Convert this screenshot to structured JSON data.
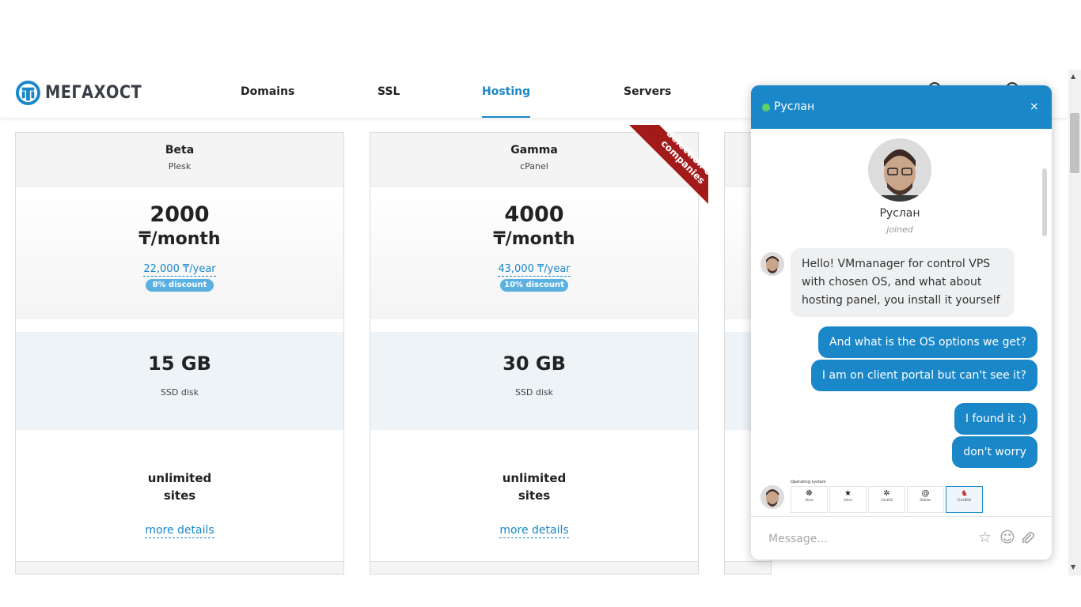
{
  "brand": {
    "logo_text": "МЕГАХОСТ"
  },
  "nav": {
    "domains": "Domains",
    "ssl": "SSL",
    "hosting": "Hosting",
    "servers": "Servers",
    "active": "Hosting"
  },
  "plans": [
    {
      "name": "Beta",
      "panel": "Plesk",
      "price": "2000",
      "price_unit": "₸/month",
      "price_year": "22,000 ₸/year",
      "discount": "8% discount",
      "disk": "15 GB",
      "disk_label": "SSD disk",
      "sites": "unlimited",
      "sites_label": "sites",
      "more": "more details"
    },
    {
      "name": "Gamma",
      "panel": "cPanel",
      "price": "4000",
      "price_unit": "₸/month",
      "price_year": "43,000 ₸/year",
      "discount": "10% discount",
      "disk": "30 GB",
      "disk_label": "SSD disk",
      "sites": "unlimited",
      "sites_label": "sites",
      "more": "more details",
      "ribbon": "Selection of companies"
    }
  ],
  "chat": {
    "agent_name": "Руслан",
    "status": "online",
    "close": "×",
    "joined": "joined",
    "messages": [
      {
        "from": "agent",
        "text": "Hello! VMmanager for control VPS with chosen OS, and what about hosting panel, you install it yourself"
      },
      {
        "from": "user",
        "text": "And what is the OS options we get?"
      },
      {
        "from": "user",
        "text": "I am on client portal but can't see it?"
      },
      {
        "from": "user",
        "text": "I found it :)"
      },
      {
        "from": "user",
        "text": "don't worry"
      }
    ],
    "attachment": {
      "title": "Operating system",
      "options": [
        "Alma",
        "Astra",
        "CentOS",
        "Debian",
        "FreeBSD"
      ]
    },
    "input_placeholder": "Message..."
  },
  "colors": {
    "accent": "#1a87c9",
    "discount_badge": "#5ab0e0",
    "ribbon": "#a31a1a",
    "disk_bg": "#edf3f6"
  },
  "icons": [
    "logo-icon",
    "star-icon",
    "smile-icon",
    "paperclip-icon",
    "close-icon",
    "online-status-icon"
  ]
}
